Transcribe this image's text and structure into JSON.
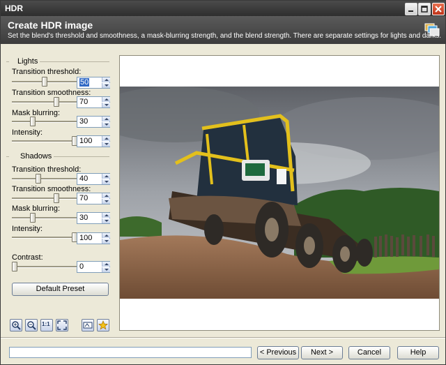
{
  "window": {
    "title": "HDR"
  },
  "header": {
    "title": "Create HDR image",
    "subtitle": "Set the blend's threshold and smoothness, a mask-blurring strength, and the blend strength. There are separate settings for lights and darks."
  },
  "lights": {
    "group_label": "Lights",
    "transition_threshold": {
      "label": "Transition threshold:",
      "value": "50",
      "level": 0.5
    },
    "transition_smoothness": {
      "label": "Transition smoothness:",
      "value": "70",
      "level": 0.7
    },
    "mask_blurring": {
      "label": "Mask blurring:",
      "value": "30",
      "level": 0.3
    },
    "intensity": {
      "label": "Intensity:",
      "value": "100",
      "level": 1.0
    }
  },
  "shadows": {
    "group_label": "Shadows",
    "transition_threshold": {
      "label": "Transition threshold:",
      "value": "40",
      "level": 0.4
    },
    "transition_smoothness": {
      "label": "Transition smoothness:",
      "value": "70",
      "level": 0.7
    },
    "mask_blurring": {
      "label": "Mask blurring:",
      "value": "30",
      "level": 0.3
    },
    "intensity": {
      "label": "Intensity:",
      "value": "100",
      "level": 1.0
    }
  },
  "contrast": {
    "label": "Contrast:",
    "value": "0",
    "level": 0.0
  },
  "buttons": {
    "default_preset": "Default Preset",
    "previous": "< Previous",
    "next": "Next >",
    "cancel": "Cancel",
    "help": "Help"
  },
  "toolbar": {
    "icons": [
      "zoom-in-icon",
      "zoom-out-icon",
      "actual-size-icon",
      "fit-to-window-icon",
      "compare-icon",
      "star-icon"
    ],
    "actual_size_label": "1:1"
  },
  "colors": {
    "title_bar": "#3c3c3c",
    "header": "#4a4a4a",
    "selection": "#316ac5",
    "button_border": "#6b7c94",
    "close_button": "#d04a2a"
  }
}
